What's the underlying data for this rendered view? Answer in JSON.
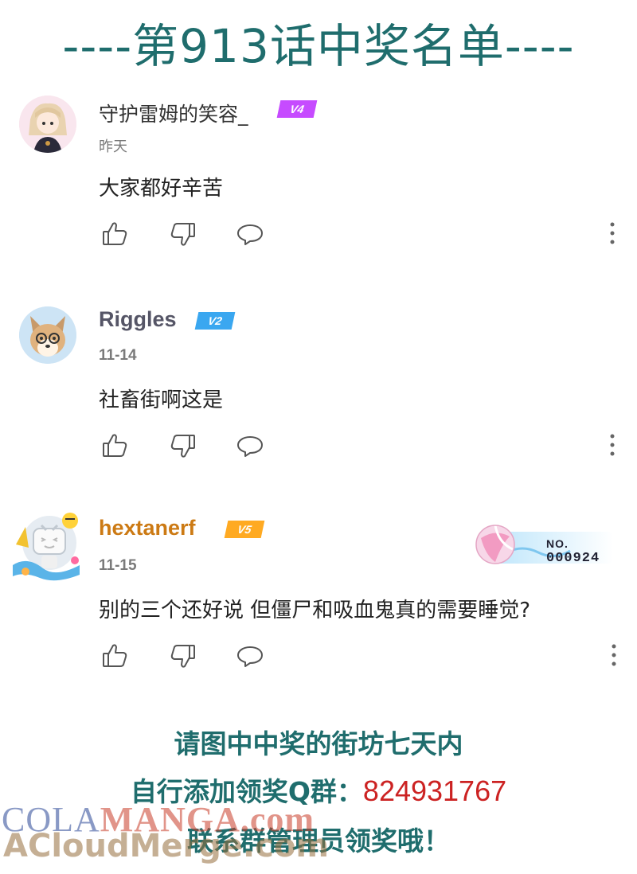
{
  "page_title": "----第913话中奖名单----",
  "comments": [
    {
      "username": "守护雷姆的笑容_",
      "level": "V4",
      "level_color": "#c64bff",
      "name_color": "#444444",
      "date": "昨天",
      "text": "大家都好辛苦",
      "avatar_icon": "anime-girl-avatar"
    },
    {
      "username": "Riggles",
      "level": "V2",
      "level_color": "#3aa7f0",
      "name_color": "#555566",
      "date": "11-14",
      "text": "社畜街啊这是",
      "avatar_icon": "dog-avatar"
    },
    {
      "username": "hextanerf",
      "level": "V5",
      "level_color": "#ffaa22",
      "name_color": "#cc7a14",
      "date": "11-15",
      "text": "别的三个还好说 但僵尸和吸血鬼真的需要睡觉?",
      "avatar_icon": "tv-mascot-avatar",
      "badge": {
        "label": "NO.",
        "number": "000924"
      }
    }
  ],
  "footer": {
    "line1": "请图中中奖的街坊七天内",
    "line2_prefix": "自行添加领奖Q群：",
    "line2_number": "824931767",
    "line3": "联系群管理员领奖哦！"
  },
  "watermark": {
    "line1_a": "COLA",
    "line1_b": "MANGA",
    "line1_c": ".com",
    "line2": "ACloudMerge.com"
  },
  "colors": {
    "accent": "#1f6d6d",
    "qq_number": "#cc2222"
  }
}
